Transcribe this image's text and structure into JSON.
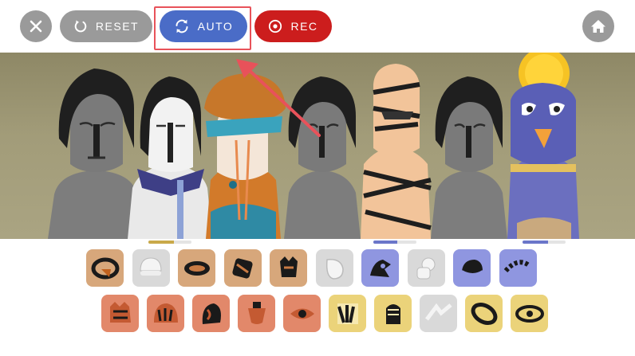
{
  "toolbar": {
    "close_icon": "close-icon",
    "reset_label": "RESET",
    "reset_icon": "reset-icon",
    "auto_label": "AUTO",
    "auto_icon": "sync-icon",
    "rec_label": "REC",
    "rec_icon": "record-icon",
    "home_icon": "home-icon",
    "colors": {
      "gray_button": "#9a9a9a",
      "auto_button": "#4a6cc7",
      "rec_button": "#cc1d1d",
      "highlight": "#e8525a"
    }
  },
  "stage": {
    "characters": [
      {
        "name": "gray-character-1"
      },
      {
        "name": "white-face-character"
      },
      {
        "name": "orange-turban-character"
      },
      {
        "name": "gray-character-2"
      },
      {
        "name": "mummy-character"
      },
      {
        "name": "gray-character-3"
      },
      {
        "name": "horus-character"
      }
    ],
    "slot_progress": [
      {
        "slot": "slot-2",
        "level": 0.6,
        "color": "#c9a94a"
      },
      {
        "slot": "slot-5",
        "level": 0.55,
        "color": "#6b76c9"
      },
      {
        "slot": "slot-7",
        "level": 0.6,
        "color": "#6b76c9"
      }
    ]
  },
  "sound_icons": {
    "row1": [
      {
        "name": "beat-orange-1",
        "color": "#d7a77b"
      },
      {
        "name": "beat-gray-1",
        "color": "#d9d9d9"
      },
      {
        "name": "beat-orange-2",
        "color": "#d7a77b"
      },
      {
        "name": "beat-orange-3",
        "color": "#d7a77b"
      },
      {
        "name": "beat-orange-4",
        "color": "#d7a77b"
      },
      {
        "name": "beat-gray-2",
        "color": "#d9d9d9"
      },
      {
        "name": "effect-blue-1",
        "color": "#8f96e0"
      },
      {
        "name": "effect-gray-1",
        "color": "#d9d9d9"
      },
      {
        "name": "effect-blue-2",
        "color": "#8f96e0"
      },
      {
        "name": "effect-blue-3",
        "color": "#8f96e0"
      }
    ],
    "row2": [
      {
        "name": "melody-orange-1",
        "color": "#e2886a"
      },
      {
        "name": "melody-orange-2",
        "color": "#e2886a"
      },
      {
        "name": "melody-orange-3",
        "color": "#e2886a"
      },
      {
        "name": "melody-orange-4",
        "color": "#e2886a"
      },
      {
        "name": "melody-orange-5",
        "color": "#e2886a"
      },
      {
        "name": "voice-yellow-1",
        "color": "#ebd37a"
      },
      {
        "name": "voice-yellow-2",
        "color": "#ebd37a"
      },
      {
        "name": "voice-gray-1",
        "color": "#d9d9d9"
      },
      {
        "name": "voice-yellow-3",
        "color": "#ebd37a"
      },
      {
        "name": "voice-yellow-4",
        "color": "#ebd37a"
      }
    ]
  }
}
